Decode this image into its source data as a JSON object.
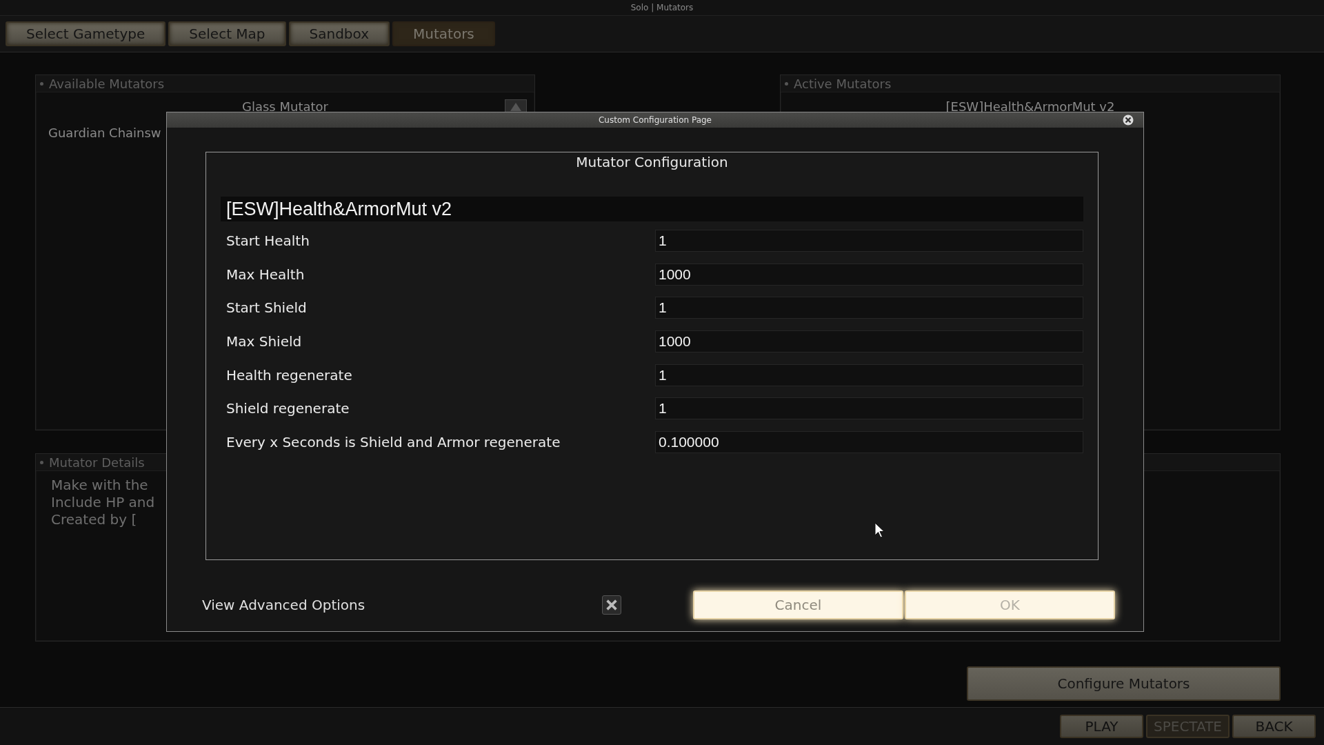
{
  "window": {
    "title": "Solo | Mutators"
  },
  "tabs": [
    {
      "label": "Select Gametype",
      "selected": false
    },
    {
      "label": "Select Map",
      "selected": false
    },
    {
      "label": "Sandbox",
      "selected": false
    },
    {
      "label": "Mutators",
      "selected": true
    }
  ],
  "available_mutators": {
    "title": "Available Mutators",
    "items": [
      {
        "kind": "centered",
        "label": "Glass Mutator"
      },
      {
        "kind": "wide",
        "label": "Guardian Chainsw"
      }
    ]
  },
  "active_mutators": {
    "title": "Active Mutators",
    "items": [
      "[ESW]Health&ArmorMut v2"
    ]
  },
  "mutator_details": {
    "title": "Mutator Details",
    "lines": [
      "Make with the",
      "Include HP and",
      "Created by ["
    ]
  },
  "configure_button": "Configure Mutators",
  "bottom_buttons": [
    {
      "label": "PLAY",
      "disabled": false
    },
    {
      "label": "SPECTATE",
      "disabled": true
    },
    {
      "label": "BACK",
      "disabled": false
    }
  ],
  "dialog": {
    "title": "Custom Configuration Page",
    "heading": "Mutator Configuration",
    "mutator_name": "[ESW]Health&ArmorMut v2",
    "settings": [
      {
        "label": "Start Health",
        "value": "1"
      },
      {
        "label": "Max Health",
        "value": "1000"
      },
      {
        "label": "Start Shield",
        "value": "1"
      },
      {
        "label": "Max Shield",
        "value": "1000"
      },
      {
        "label": "Health regenerate",
        "value": "1"
      },
      {
        "label": "Shield regenerate",
        "value": "1"
      },
      {
        "label": "Every x Seconds is Shield and Armor regenerate",
        "value": "0.100000"
      }
    ],
    "advanced_options": {
      "label": "View Advanced Options",
      "checked": true
    },
    "buttons": [
      {
        "label": "Cancel",
        "disabled": false
      },
      {
        "label": "OK",
        "disabled": true
      }
    ]
  }
}
